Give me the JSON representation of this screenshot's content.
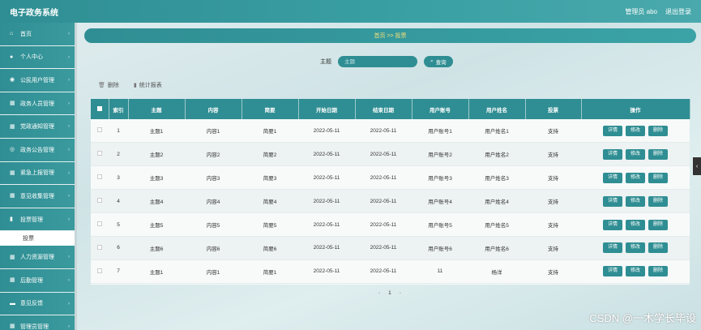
{
  "header": {
    "title": "电子政务系统",
    "user": "管理员 abo",
    "logout": "退出登录"
  },
  "sidebar": {
    "items": [
      {
        "label": "首页",
        "icon": "home-icon",
        "glyph": "⌂"
      },
      {
        "label": "个人中心",
        "icon": "person-icon",
        "glyph": "●"
      },
      {
        "label": "公民用户管理",
        "icon": "group-icon",
        "glyph": "◉"
      },
      {
        "label": "政务人员管理",
        "icon": "grid-icon",
        "glyph": "▦"
      },
      {
        "label": "党政通知管理",
        "icon": "grid-icon",
        "glyph": "▦"
      },
      {
        "label": "政务公告管理",
        "icon": "grid-icon",
        "glyph": "◎"
      },
      {
        "label": "紧急上报管理",
        "icon": "grid-icon",
        "glyph": "▦"
      },
      {
        "label": "意见收集管理",
        "icon": "grid-icon",
        "glyph": "▦"
      },
      {
        "label": "投票管理",
        "icon": "chart-icon",
        "glyph": "▮"
      }
    ],
    "sub_item": "投票",
    "items_after": [
      {
        "label": "人力资源管理",
        "icon": "grid-icon",
        "glyph": "▦"
      },
      {
        "label": "后勤管理",
        "icon": "grid-icon",
        "glyph": "▦"
      },
      {
        "label": "意见反馈",
        "icon": "grid-icon",
        "glyph": "▬"
      },
      {
        "label": "管理员管理",
        "icon": "grid-icon",
        "glyph": "▦"
      }
    ]
  },
  "breadcrumb": "首页 >> 投票",
  "search": {
    "label": "主题",
    "placeholder": "主题",
    "button": "查询"
  },
  "actions": {
    "delete": "删除",
    "report": "统计报表"
  },
  "table": {
    "headers": [
      "索引",
      "主题",
      "内容",
      "简要",
      "开始日期",
      "结束日期",
      "用户账号",
      "用户姓名",
      "投票",
      "操作"
    ],
    "rows": [
      [
        "1",
        "主题1",
        "内容1",
        "简要1",
        "2022-05-11",
        "2022-05-11",
        "用户账号1",
        "用户姓名1",
        "支持"
      ],
      [
        "2",
        "主题2",
        "内容2",
        "简要2",
        "2022-05-11",
        "2022-05-11",
        "用户账号2",
        "用户姓名2",
        "支持"
      ],
      [
        "3",
        "主题3",
        "内容3",
        "简要3",
        "2022-05-11",
        "2022-05-11",
        "用户账号3",
        "用户姓名3",
        "支持"
      ],
      [
        "4",
        "主题4",
        "内容4",
        "简要4",
        "2022-05-11",
        "2022-05-11",
        "用户账号4",
        "用户姓名4",
        "支持"
      ],
      [
        "5",
        "主题5",
        "内容5",
        "简要5",
        "2022-05-11",
        "2022-05-11",
        "用户账号5",
        "用户姓名5",
        "支持"
      ],
      [
        "6",
        "主题6",
        "内容6",
        "简要6",
        "2022-05-11",
        "2022-05-11",
        "用户账号6",
        "用户姓名6",
        "支持"
      ],
      [
        "7",
        "主题1",
        "内容1",
        "简要1",
        "2022-05-11",
        "2022-05-11",
        "11",
        "杨洋",
        "支持"
      ]
    ],
    "row_buttons": {
      "detail": "详情",
      "edit": "修改",
      "delete": "删除"
    }
  },
  "pager": {
    "prev": "‹",
    "current": "1",
    "next": "›"
  },
  "watermark": "CSDN @一木学长毕设",
  "colors": {
    "accent": "#2f8e93",
    "crumb_text": "#f6e07a"
  }
}
